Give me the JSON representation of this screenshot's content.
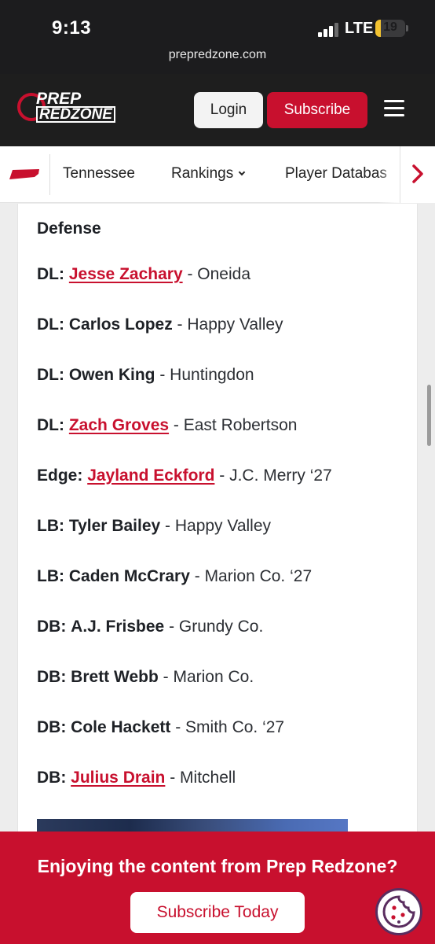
{
  "status_bar": {
    "time": "9:13",
    "network": "LTE",
    "battery": "19",
    "battery_level": 0.19,
    "url": "prepredzone.com"
  },
  "header": {
    "logo_line1": "PREP",
    "logo_line2": "REDZONE",
    "login_label": "Login",
    "subscribe_label": "Subscribe"
  },
  "state_nav": {
    "items": [
      {
        "label": "Tennessee"
      },
      {
        "label": "Rankings"
      },
      {
        "label": "Player Databas"
      }
    ]
  },
  "article": {
    "section_title": "Defense",
    "players": [
      {
        "position": "DL:",
        "name": "Jesse Zachary",
        "linked": true,
        "rest": " - Oneida"
      },
      {
        "position": "DL:",
        "name": "Carlos Lopez",
        "linked": false,
        "rest": " - Happy Valley"
      },
      {
        "position": "DL:",
        "name": "Owen King",
        "linked": false,
        "rest": " - Huntingdon"
      },
      {
        "position": "DL:",
        "name": "Zach Groves",
        "linked": true,
        "rest": " - East Robertson"
      },
      {
        "position": "Edge:",
        "name": "Jayland Eckford",
        "linked": true,
        "rest": " - J.C. Merry ‘27"
      },
      {
        "position": "LB:",
        "name": "Tyler Bailey",
        "linked": false,
        "rest": " - Happy Valley"
      },
      {
        "position": "LB:",
        "name": "Caden McCrary",
        "linked": false,
        "rest": " - Marion Co. ‘27"
      },
      {
        "position": "DB:",
        "name": "A.J. Frisbee",
        "linked": false,
        "rest": " - Grundy Co."
      },
      {
        "position": "DB:",
        "name": "Brett Webb",
        "linked": false,
        "rest": " - Marion Co."
      },
      {
        "position": "DB:",
        "name": "Cole Hackett",
        "linked": false,
        "rest": " - Smith Co. ‘27"
      },
      {
        "position": "DB:",
        "name": "Julius Drain",
        "linked": true,
        "rest": " - Mitchell"
      }
    ]
  },
  "banner": {
    "text": "Enjoying the content from Prep Redzone?",
    "button_label": "Subscribe Today"
  },
  "colors": {
    "brand_red": "#c8102e",
    "header_bg": "#1e1e1e"
  },
  "icons": [
    "signal-icon",
    "battery-icon",
    "hamburger-icon",
    "tennessee-flag-icon",
    "chevron-down-icon",
    "chevron-right-icon",
    "cookie-icon"
  ]
}
